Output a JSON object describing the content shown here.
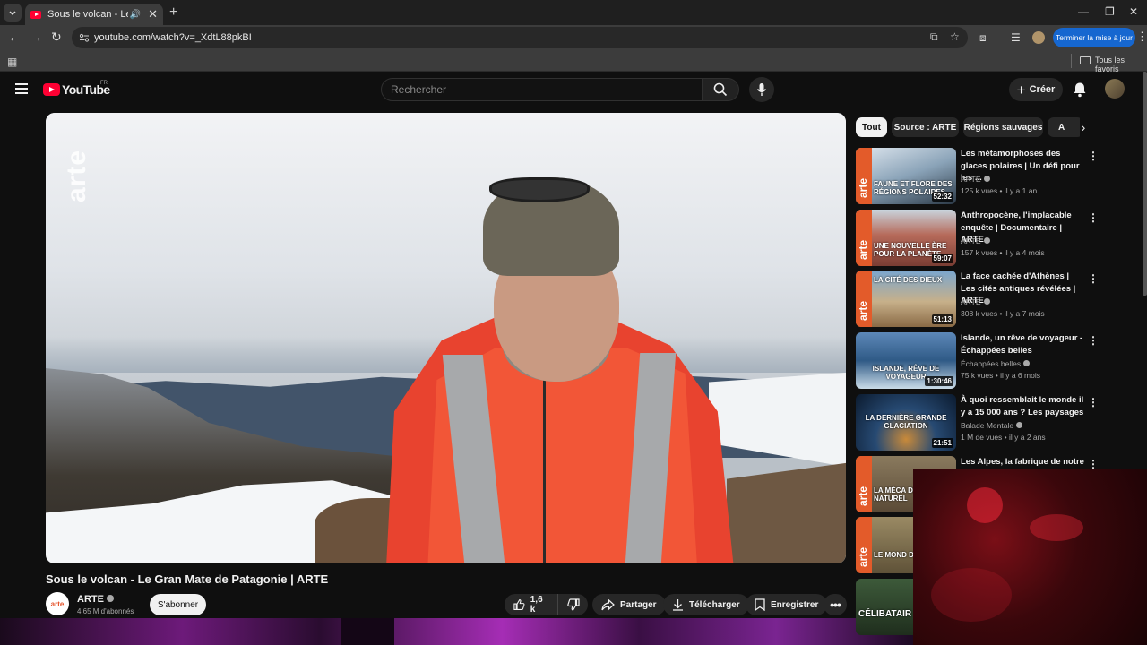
{
  "browser": {
    "tab_title": "Sous le volcan - Le Gran Mate de Patagonie | ARTE - YouTube",
    "tab_audio": "🔊",
    "url": "youtube.com/watch?v=_XdtL88pkBI",
    "update_label": "Terminer la mise à jour",
    "bookmarks_all": "Tous les favoris"
  },
  "masthead": {
    "logo_text": "YouTube",
    "country": "FR",
    "search_placeholder": "Rechercher",
    "create_label": "Créer"
  },
  "player": {
    "watermark": "arte"
  },
  "video": {
    "title": "Sous le volcan - Le Gran Mate de Patagonie | ARTE",
    "channel": "ARTE",
    "channel_avatar_text": "arte",
    "subscribers": "4,65 M d'abonnés",
    "subscribe_label": "S'abonner",
    "likes": "1,6 k",
    "share_label": "Partager",
    "download_label": "Télécharger",
    "save_label": "Enregistrer"
  },
  "chips": [
    "Tout",
    "Source : ARTE",
    "Régions sauvages",
    "A"
  ],
  "recommendations": [
    {
      "title": "Les métamorphoses des glaces polaires | Un défi pour les ...",
      "channel": "ARTE",
      "meta": "125 k vues • il y a 1 an",
      "duration": "52:32",
      "thumb_text": "FAUNE ET FLORE DES RÉGIONS POLAIRES",
      "verified": true
    },
    {
      "title": "Anthropocène, l'implacable enquête | Documentaire | ARTE",
      "channel": "ARTE",
      "meta": "157 k vues • il y a 4 mois",
      "duration": "59:07",
      "thumb_text": "UNE NOUVELLE ÈRE POUR LA PLANÈTE",
      "verified": true
    },
    {
      "title": "La face cachée d'Athènes | Les cités antiques révélées | ARTE",
      "channel": "ARTE",
      "meta": "308 k vues • il y a 7 mois",
      "duration": "51:13",
      "thumb_text": "LA CITÉ DES DIEUX",
      "verified": true
    },
    {
      "title": "Islande, un rêve de voyageur - Échappées belles",
      "channel": "Échappées belles",
      "meta": "75 k vues • il y a 6 mois",
      "duration": "1:30:46",
      "thumb_text": "ISLANDE, RÊVE DE VOYAGEUR",
      "verified": true
    },
    {
      "title": "À quoi ressemblait le monde il y a 15 000 ans ? Les paysages ...",
      "channel": "Balade Mentale",
      "meta": "1 M de vues • il y a 2 ans",
      "duration": "21:51",
      "thumb_text": "LA DERNIÈRE GRANDE GLACIATION",
      "verified": true
    },
    {
      "title": "Les Alpes, la fabrique de notre",
      "channel": "",
      "meta": "",
      "duration": "",
      "thumb_text": "LA MÉCA DES FORC NATUREL",
      "verified": false
    }
  ],
  "extra_thumbs": [
    "LE MOND DES RAT",
    "CÉLIBATAIR"
  ],
  "colors": {
    "background": "#0f0f0f",
    "accent_red": "#ff0033",
    "arte_orange": "#e35b2a",
    "update_blue": "#1667d0"
  }
}
